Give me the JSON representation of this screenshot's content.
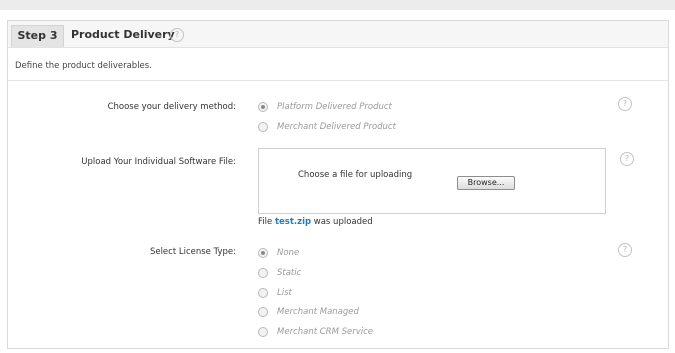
{
  "step": {
    "tab_label": "Step 3",
    "title": "Product Delivery",
    "description": "Define the product deliverables."
  },
  "delivery": {
    "label": "Choose your delivery method:",
    "options": [
      {
        "label": "Platform Delivered Product",
        "checked": true
      },
      {
        "label": "Merchant Delivered Product",
        "checked": false
      }
    ]
  },
  "upload": {
    "label": "Upload Your Individual Software File:",
    "prompt": "Choose a file for uploading",
    "browse_label": "Browse...",
    "status_prefix": "File",
    "filename": "test.zip",
    "status_suffix": "was uploaded"
  },
  "license": {
    "label": "Select License Type:",
    "options": [
      {
        "label": "None",
        "checked": true
      },
      {
        "label": "Static",
        "checked": false
      },
      {
        "label": "List",
        "checked": false
      },
      {
        "label": "Merchant Managed",
        "checked": false
      },
      {
        "label": "Merchant CRM Service",
        "checked": false
      }
    ]
  },
  "help_icon_glyph": "?"
}
